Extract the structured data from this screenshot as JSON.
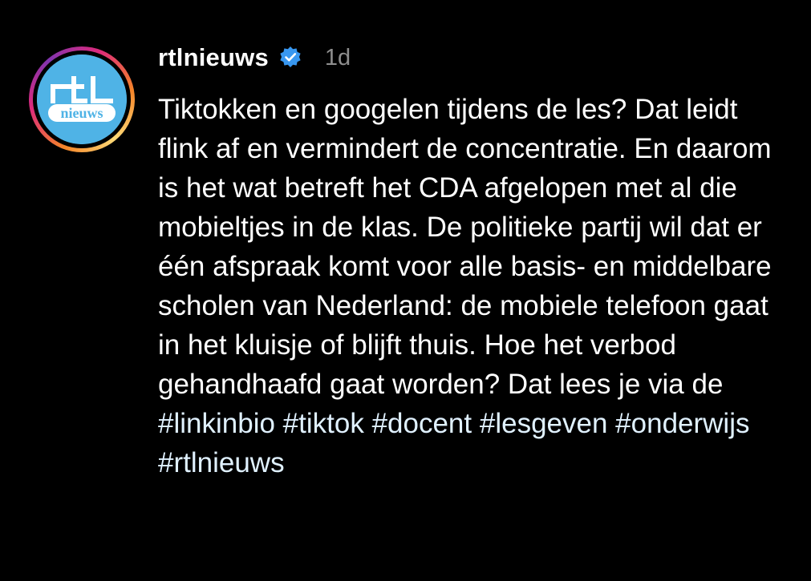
{
  "post": {
    "avatar": {
      "logo_top": "rtl",
      "logo_bottom": "nieuws",
      "bg_color": "#4fb3e6"
    },
    "username": "rtlnieuws",
    "verified_icon": "verified-badge-icon",
    "time_ago": "1d",
    "caption_text": "Tiktokken en googelen tijdens de les? Dat leidt flink af en vermindert de concentratie. En daarom is het wat betreft het CDA afgelopen met al die mobieltjes in de klas. De politieke partij wil dat er één afspraak komt voor alle basis- en middelbare scholen van Nederland: de mobiele telefoon gaat in het kluisje of blijft thuis. Hoe het verbod gehandhaafd gaat worden? Dat lees je via de",
    "hashtags": [
      "#linkinbio",
      "#tiktok",
      "#docent",
      "#lesgeven",
      "#onderwijs",
      "#rtlnieuws"
    ],
    "hashtag_color": "#e0f1ff",
    "verified_color": "#3897f0"
  }
}
